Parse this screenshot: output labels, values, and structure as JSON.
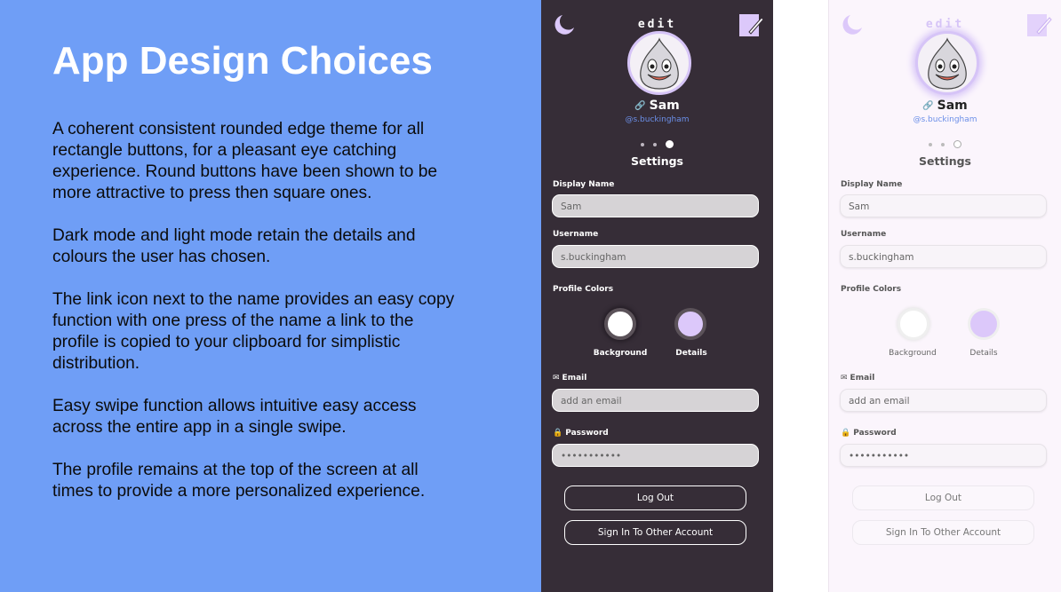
{
  "slide": {
    "title": "App Design Choices",
    "paragraphs": [
      "A coherent consistent rounded edge theme for all rectangle buttons, for a pleasant eye catching experience. Round buttons have been shown to be more attractive to press then square ones.",
      "Dark mode and light mode retain the details and colours the user has chosen.",
      "The link icon next to the name provides an easy copy function with one press of the name a link to the profile is copied to your clipboard for simplistic distribution.",
      "Easy swipe function allows intuitive easy access across the entire app in a single swipe.",
      "The profile remains at the top of the screen at all times to provide a more personalized experience."
    ]
  },
  "app": {
    "edit_label": "edit",
    "name": "Sam",
    "handle": "@s.buckingham",
    "settings_title": "Settings",
    "display_name_label": "Display Name",
    "display_name_value": "Sam",
    "username_label": "Username",
    "username_value": "s.buckingham",
    "profile_colors_label": "Profile Colors",
    "background_label": "Background",
    "details_label": "Details",
    "email_label": "Email",
    "email_placeholder": "add an email",
    "password_label": "Password",
    "password_value": "•••••••••••",
    "logout_label": "Log Out",
    "signin_label": "Sign In To Other Account",
    "page_dots": 3,
    "active_dot": 3
  },
  "colors": {
    "slide_bg": "#6f9ef6",
    "dark_bg": "#362d37",
    "light_bg": "#fbf5fc",
    "accent_purple": "#dcc8fa",
    "handle_blue": "#6b8fe8"
  },
  "icons": [
    "moon-icon",
    "edit-note-icon",
    "link-icon",
    "mail-icon",
    "lock-icon"
  ]
}
